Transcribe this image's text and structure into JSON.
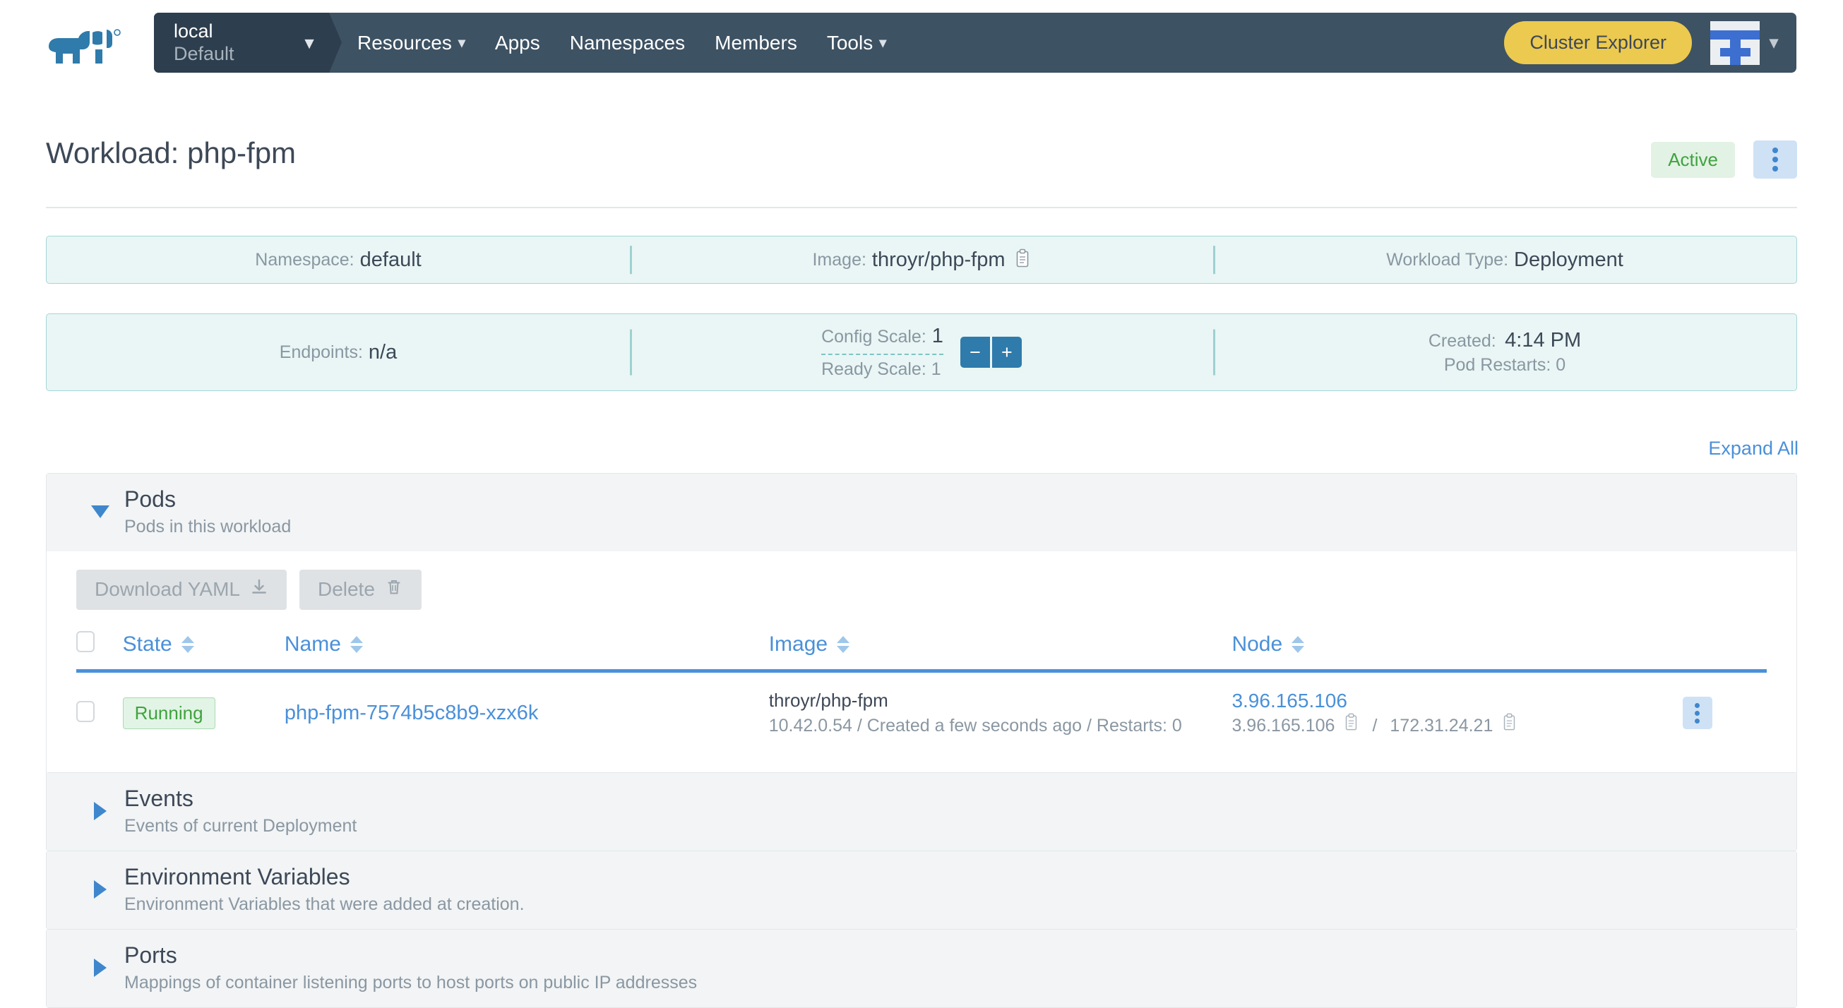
{
  "nav": {
    "logo_icon": "rancher-cow-logo",
    "cluster": {
      "name": "local",
      "project": "Default",
      "caret_icon": "chevron-down-icon"
    },
    "links": [
      {
        "label": "Resources",
        "has_caret": true,
        "icon": "chevron-down-icon"
      },
      {
        "label": "Apps",
        "has_caret": false
      },
      {
        "label": "Namespaces",
        "has_caret": false
      },
      {
        "label": "Members",
        "has_caret": false
      },
      {
        "label": "Tools",
        "has_caret": true,
        "icon": "chevron-down-icon"
      }
    ],
    "cluster_explorer_label": "Cluster Explorer",
    "avatar_icon": "user-avatar-icon",
    "avatar_caret_icon": "chevron-down-icon",
    "colors": {
      "bar": "#3d5263",
      "switcher": "#2d3e4e",
      "accent": "#ecc94f"
    }
  },
  "header": {
    "title": "Workload: php-fpm",
    "status_badge": "Active",
    "status_color": "#3fa33f",
    "actions_icon": "kebab-menu-icon"
  },
  "info": {
    "row1": [
      {
        "label": "Namespace:",
        "value": "default",
        "copy": false
      },
      {
        "label": "Image:",
        "value": "throyr/php-fpm",
        "copy": true,
        "copy_icon": "copy-clipboard-icon"
      },
      {
        "label": "Workload Type:",
        "value": "Deployment",
        "copy": false
      }
    ],
    "endpoints": {
      "label": "Endpoints:",
      "value": "n/a"
    },
    "scale": {
      "config_label": "Config Scale:",
      "config_value": "1",
      "ready_label": "Ready Scale: 1",
      "decrement_label": "−",
      "increment_label": "+",
      "decrement_icon": "minus-icon",
      "increment_icon": "plus-icon"
    },
    "created": {
      "label": "Created:",
      "value": "4:14 PM",
      "restarts": "Pod Restarts: 0"
    }
  },
  "expand_all_label": "Expand All",
  "sections": [
    {
      "id": "pods",
      "title": "Pods",
      "subtitle": "Pods in this workload",
      "expanded": true,
      "triangle_icon": "triangle-down-icon"
    },
    {
      "id": "events",
      "title": "Events",
      "subtitle": "Events of current Deployment",
      "expanded": false,
      "triangle_icon": "triangle-right-icon"
    },
    {
      "id": "environment-variables",
      "title": "Environment Variables",
      "subtitle": "Environment Variables that were added at creation.",
      "expanded": false,
      "triangle_icon": "triangle-right-icon"
    },
    {
      "id": "ports",
      "title": "Ports",
      "subtitle": "Mappings of container listening ports to host ports on public IP addresses",
      "expanded": false,
      "triangle_icon": "triangle-right-icon"
    }
  ],
  "pods_table": {
    "toolbar": [
      {
        "label": "Download YAML",
        "icon": "download-icon",
        "disabled": true
      },
      {
        "label": "Delete",
        "icon": "trash-icon",
        "disabled": true
      }
    ],
    "columns": [
      {
        "key": "state",
        "label": "State",
        "sortable": true,
        "sort_icon": "sort-updown-icon"
      },
      {
        "key": "name",
        "label": "Name",
        "sortable": true,
        "sort_icon": "sort-updown-icon"
      },
      {
        "key": "image",
        "label": "Image",
        "sortable": true,
        "sort_icon": "sort-updown-icon"
      },
      {
        "key": "node",
        "label": "Node",
        "sortable": true,
        "sort_icon": "sort-updown-icon"
      }
    ],
    "rows": [
      {
        "state": "Running",
        "name": "php-fpm-7574b5c8b9-xzx6k",
        "image": "throyr/php-fpm",
        "image_sub": "10.42.0.54 / Created a few seconds ago / Restarts: 0",
        "node_link": "3.96.165.106",
        "node_public_ip": "3.96.165.106",
        "node_private_ip": "172.31.24.21",
        "node_separator": "/",
        "copy_icon": "copy-clipboard-icon",
        "actions_icon": "kebab-menu-icon"
      }
    ]
  }
}
